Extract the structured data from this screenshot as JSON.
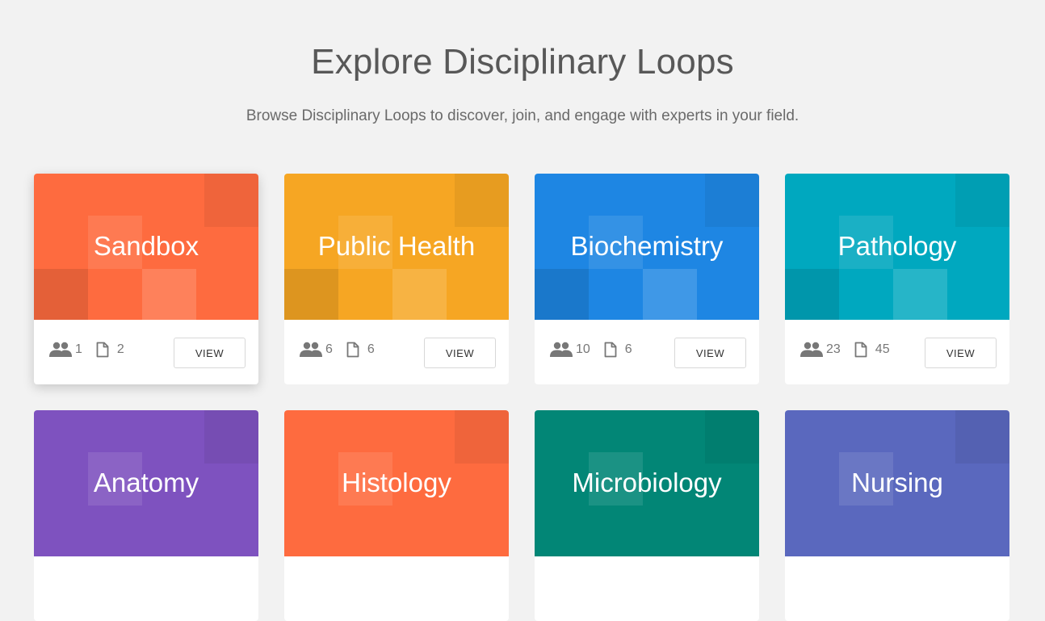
{
  "header": {
    "title": "Explore Disciplinary Loops",
    "subtitle": "Browse Disciplinary Loops to discover, join, and engage with experts in your field."
  },
  "cards": [
    {
      "name": "Sandbox",
      "color": "#fe6b3f",
      "members": "1",
      "documents": "2",
      "button": "VIEW"
    },
    {
      "name": "Public Health",
      "color": "#f6a623",
      "members": "6",
      "documents": "6",
      "button": "VIEW"
    },
    {
      "name": "Biochemistry",
      "color": "#1e86e3",
      "members": "10",
      "documents": "6",
      "button": "VIEW"
    },
    {
      "name": "Pathology",
      "color": "#00a8bf",
      "members": "23",
      "documents": "45",
      "button": "VIEW"
    },
    {
      "name": "Anatomy",
      "color": "#7e52bf",
      "members": "",
      "documents": "",
      "button": ""
    },
    {
      "name": "Histology",
      "color": "#fe6b3f",
      "members": "",
      "documents": "",
      "button": ""
    },
    {
      "name": "Microbiology",
      "color": "#028676",
      "members": "",
      "documents": "",
      "button": ""
    },
    {
      "name": "Nursing",
      "color": "#5a68be",
      "members": "",
      "documents": "",
      "button": ""
    }
  ],
  "icons": {
    "members": "people-icon",
    "documents": "document-icon"
  }
}
